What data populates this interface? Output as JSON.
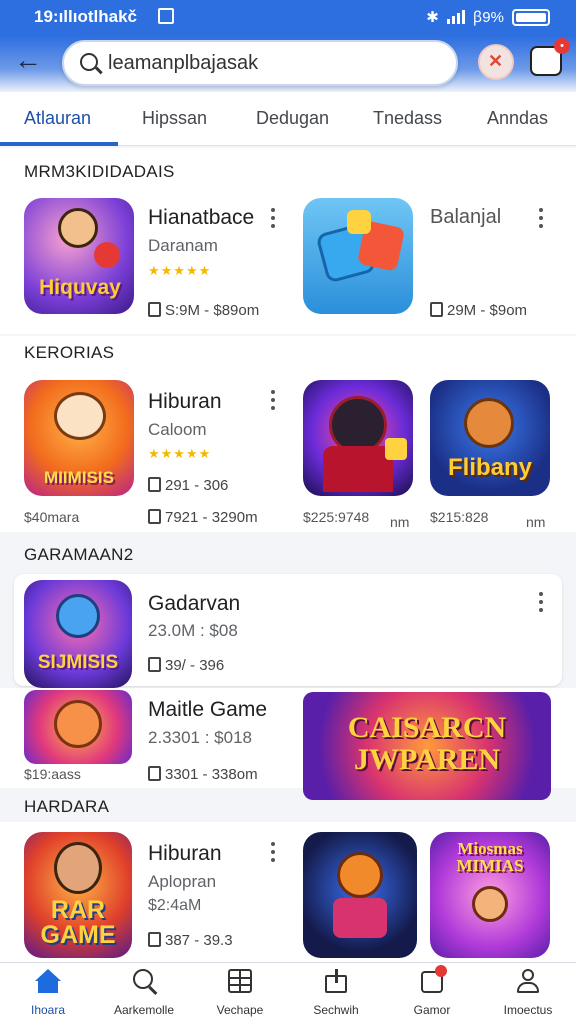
{
  "status_bar": {
    "time": "19:ıllıotlhakč",
    "battery_text": "ꞵ9%"
  },
  "search": {
    "placeholder": "",
    "value": "leamanplbajasak"
  },
  "tabs": [
    "Atlauran",
    "Hipssan",
    "Dedugan",
    "Tnedass",
    "Anndas"
  ],
  "sections": [
    {
      "title": "MRM3KIDIDADAIS",
      "apps": [
        {
          "name": "Hianatbace",
          "sub": "Daranam",
          "stars": "★★★★★",
          "downloads": "S:9M",
          "size": "$89om",
          "icon_text": "Hiquvay"
        },
        {
          "name": "Balanjal",
          "sub": "",
          "downloads": "29M",
          "size": "$9om"
        }
      ]
    },
    {
      "title": "KERORIAS",
      "apps": [
        {
          "name": "Hiburan",
          "sub": "Caloom",
          "stars": "★★★★★",
          "downloads": "291",
          "size": "306",
          "icon_text": "MIIMISIS"
        }
      ],
      "row_meta": "7921  -  3290m",
      "prices": [
        "$40mara",
        "$225:9748",
        "$215:828"
      ],
      "price_units": [
        "nm",
        "nm"
      ],
      "tile_text": "Flibany"
    },
    {
      "title": "GARAMAAN2",
      "apps": [
        {
          "name": "Gadarvan",
          "sub": "23.0M : $08",
          "downloads": "39/",
          "size": "396",
          "icon_text": "SIJMISIS"
        },
        {
          "name": "Maitle Game",
          "sub": "2.3301 : $018",
          "downloads": "3301",
          "size": "338om"
        }
      ],
      "price": "$19:aass",
      "banner_text": [
        "CAISARCN",
        "JWPAREN"
      ]
    },
    {
      "title": "HARDARA",
      "apps": [
        {
          "name": "Hiburan",
          "sub": "Aplopran",
          "price": "$2:4aM",
          "downloads": "387",
          "size": "39.3",
          "icon_text": [
            "RAR",
            "GAME"
          ]
        }
      ],
      "tile_text": [
        "Miosmas",
        "MIMIAS"
      ]
    }
  ],
  "bottom_nav": [
    "Ihoara",
    "Aarkemolle",
    "Vechape",
    "Sechwih",
    "Gamor",
    "Imoectus"
  ],
  "colors": {
    "primary": "#2e6fe0",
    "accent": "#1e4fa8",
    "star": "#f5b800"
  }
}
